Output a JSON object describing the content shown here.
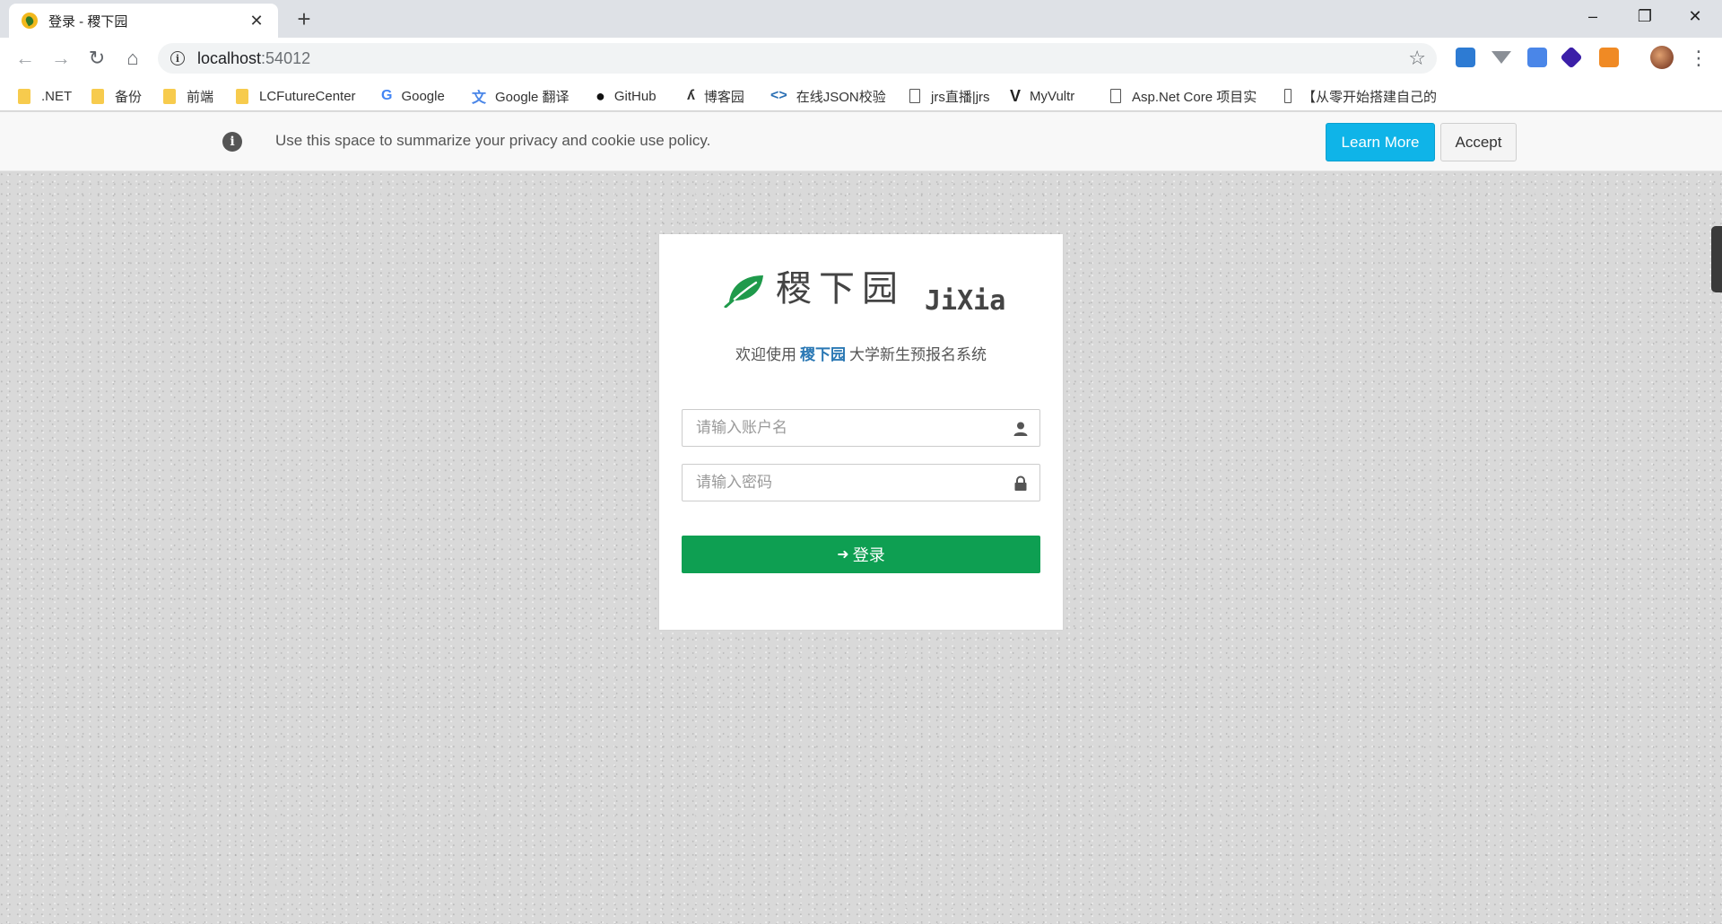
{
  "browser": {
    "tab_title": "登录 - 稷下园",
    "tab_close": "✕",
    "new_tab": "+",
    "url_host": "localhost",
    "url_port": ":54012",
    "window_controls": {
      "minimize": "–",
      "maximize": "❐",
      "close": "✕"
    }
  },
  "bookmarks": [
    {
      "label": ".NET",
      "icon": "folder-icon"
    },
    {
      "label": "备份",
      "icon": "folder-icon"
    },
    {
      "label": "前端",
      "icon": "folder-icon"
    },
    {
      "label": "LCFutureCenter",
      "icon": "folder-icon"
    },
    {
      "label": "Google",
      "icon": "google-icon"
    },
    {
      "label": "Google 翻译",
      "icon": "translate-icon"
    },
    {
      "label": "GitHub",
      "icon": "github-icon"
    },
    {
      "label": "博客园",
      "icon": "cnblogs-icon"
    },
    {
      "label": "在线JSON校验",
      "icon": "json-icon"
    },
    {
      "label": "jrs直播|jrs",
      "icon": "page-icon"
    },
    {
      "label": "MyVultr",
      "icon": "vultr-icon"
    },
    {
      "label": "Asp.Net Core 项目实",
      "icon": "page-icon"
    },
    {
      "label": "【从零开始搭建自己的",
      "icon": "page-icon"
    }
  ],
  "cookie": {
    "text": "Use this space to summarize your privacy and cookie use policy.",
    "learn_more": "Learn More",
    "accept": "Accept"
  },
  "login": {
    "brand_cn": "稷下园",
    "brand_en": "JiXia",
    "welcome_prefix": "欢迎使用",
    "welcome_brand": "稷下园",
    "welcome_suffix": "大学新生预报名系统",
    "username_placeholder": "请输入账户名",
    "password_placeholder": "请输入密码",
    "submit_label": "登录"
  },
  "colors": {
    "brand_green": "#0e9f52",
    "link_blue": "#2a78b4",
    "learn_more_bg": "#0fb4e8"
  }
}
